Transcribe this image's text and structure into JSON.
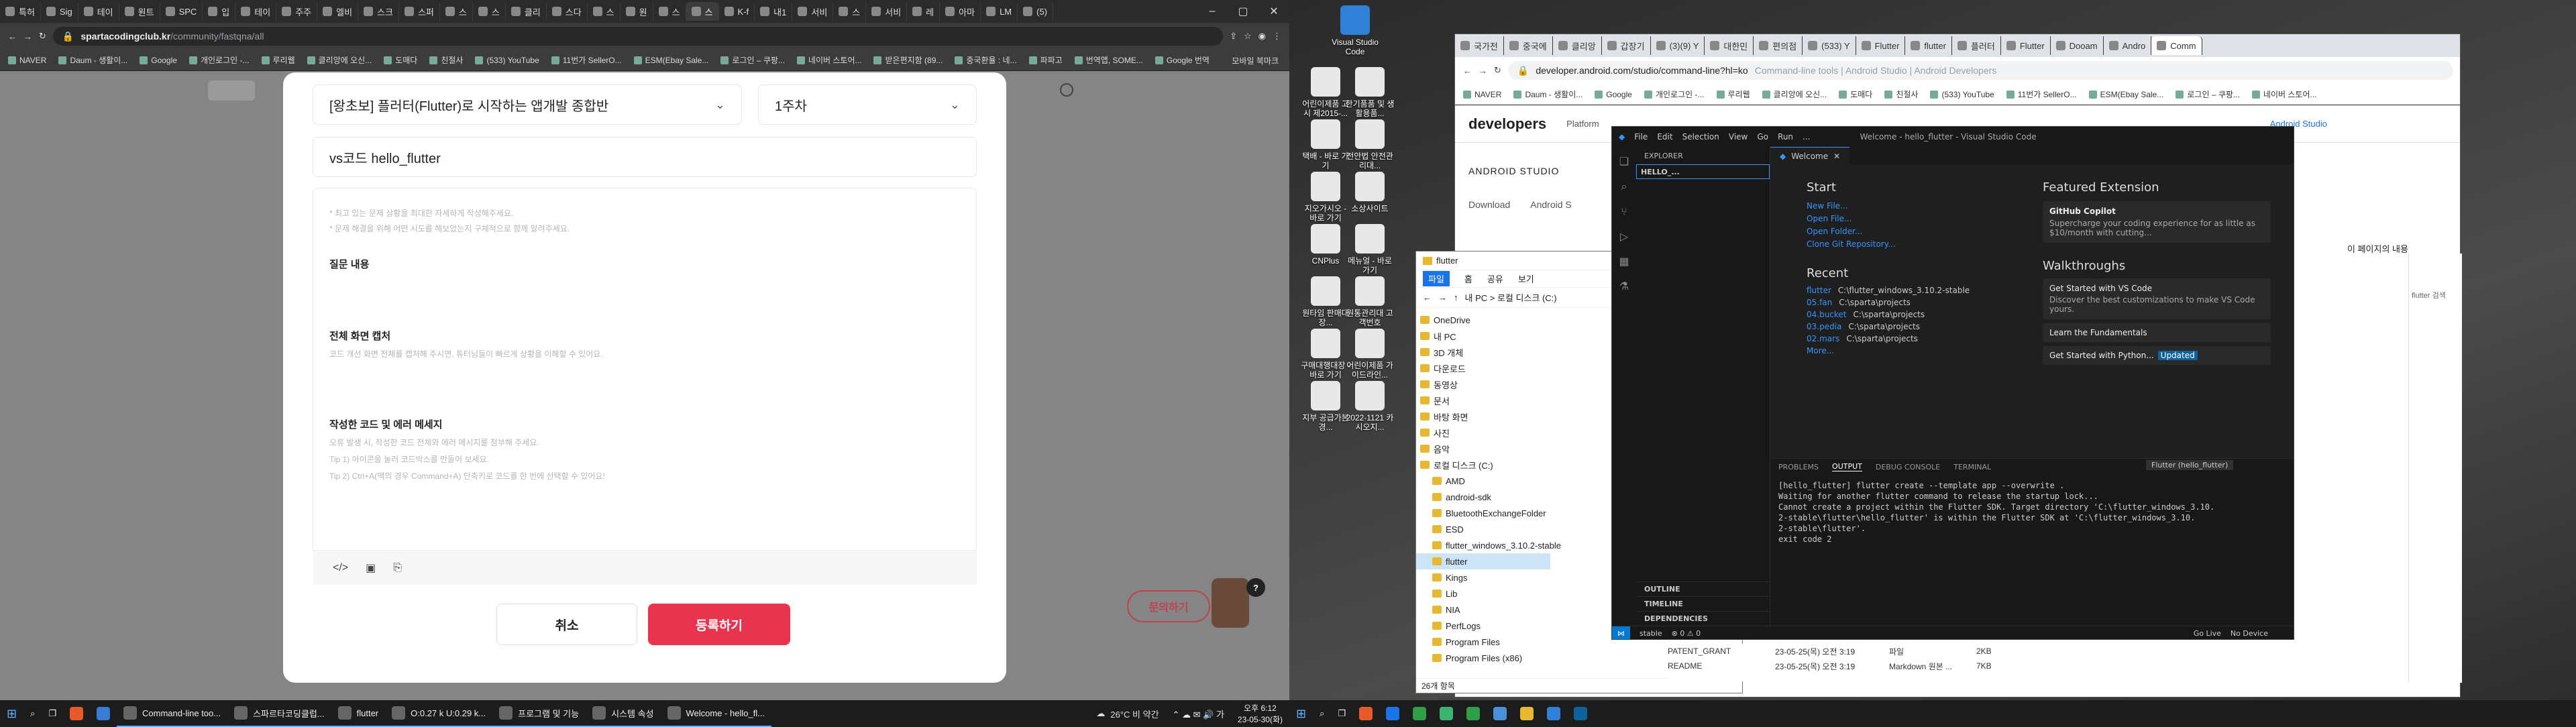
{
  "left_browser": {
    "tabs": [
      "특허",
      "Sig",
      "테이",
      "원트",
      "SPC",
      "입",
      "테이",
      "주주",
      "엘비",
      "스크",
      "스퍼",
      "스",
      "스",
      "클리",
      "스다",
      "스",
      "원",
      "스",
      "스",
      "K-f",
      "내1",
      "서비",
      "스",
      "서비",
      "레",
      "아마",
      "LM",
      "(5)"
    ],
    "active_tab_label": "스",
    "url_domain": "spartacodingclub.kr",
    "url_path": "/community/fastqna/all",
    "bookmarks": [
      "NAVER",
      "Daum - 생활이...",
      "Google",
      "개인로그인 -...",
      "루리웹",
      "클리앙에 오신...",
      "도매다",
      "친절사",
      "(533) YouTube",
      "11번가 SellerO...",
      "ESM(Ebay Sale...",
      "로그인 – 쿠팡...",
      "네이버 스토어...",
      "받은편지함 (89...",
      "중국환율 : 네...",
      "파파고",
      "번역앱, SOME...",
      "Google 번역"
    ],
    "bookmarks_all": "모바일 북마크"
  },
  "modal": {
    "course_select": "[왕초보] 플러터(Flutter)로 시작하는 앱개발 종합반",
    "week_select": "1주차",
    "title_value": "vs코드 hello_flutter",
    "hint1": "* 최고 있는 문제 상황을 최대한 자세하게 작성해주세요.",
    "hint2": "* 문제 해결을 위해 어떤 시도를 해보았는지 구체적으로 함께 알려주세요.",
    "q_header": "질문 내용",
    "screen_header": "전체 화면 캡처",
    "screen_hint": "코드 개선 화면 전체를 캡처해 주시면, 튜터님들이 빠르게 상황을 이해할 수 있어요.",
    "code_header": "작성한 코드 및 에러 메세지",
    "code_hint1": "오류 발생 시, 작성한 코드 전체와 에러 메시지를 첨부해 주세요.",
    "code_hint2": "Tip 1) 아이콘을 눌러 코드박스를 만들어 보세요.",
    "code_hint3": "Tip 2) Ctrl+A(맥의 경우 Command+A) 단축키로 코드를 한 번에 선택할 수 있어요!",
    "cancel_label": "취소",
    "submit_label": "등록하기",
    "help_label": "문의하기",
    "help_badge": "?"
  },
  "left_taskbar": {
    "items": [
      "Command-line too...",
      "스파르타코딩클럽...",
      "flutter",
      "O:0.27 k U:0.29 k...",
      "프로그램 및 기능",
      "시스템 속성",
      "Welcome - hello_fl..."
    ],
    "weather": "26°C 비 약간",
    "time": "오후 6:12",
    "date": "23-05-30(화)"
  },
  "desktop_icons": [
    "Visual Studio Code",
    "어린이제품 고시 제2015-...",
    "한기품품 및 생활용품...",
    "택배 - 바로 가기",
    "전안법 안전관리대...",
    "지오가시오 - 바로 가기",
    "소상사이트",
    "CNPlus",
    "메뉴얼 - 바로 가기",
    "원타임 판매대장...",
    "원통관리대 고객번호",
    "구매대행대장 - 바로 가기",
    "어린이제품 가이드라인...",
    "지부 공급가본경...",
    "2022-1121 카시오지..."
  ],
  "chrome2": {
    "tabs": [
      "국가전",
      "중국에",
      "클리앙",
      "갑장기",
      "(3)(9) Y",
      "대한민",
      "편의점",
      "(533) Y",
      "Flutter",
      "flutter",
      "플러터",
      "Flutter",
      "Dooam",
      "Andro",
      "Comm"
    ],
    "url": "developer.android.com/studio/command-line?hl=ko",
    "url_crumb": "Command-line tools | Android Studio | Android Developers",
    "bookmarks": [
      "NAVER",
      "Daum - 생활이...",
      "Google",
      "개인로그인 -...",
      "루리웹",
      "클리앙에 오신...",
      "도매다",
      "친절사",
      "(533) YouTube",
      "11번가 SellerO...",
      "ESM(Ebay Sale...",
      "로그인 – 쿠팡...",
      "네이버 스토어..."
    ],
    "brand": "developers",
    "nav1": "Platform",
    "nav2": "Android Studio",
    "section": "ANDROID STUDIO",
    "sub1": "Download",
    "sub2": "Android S",
    "page_note": "이 페이지의 내용",
    "search_ph": "flutter 검색"
  },
  "explorer": {
    "title": "flutter",
    "ribbon": [
      "파일",
      "홈",
      "공유",
      "보기"
    ],
    "path": "내 PC > 로컬 디스크 (C:)",
    "tree": [
      "OneDrive",
      "내 PC",
      "3D 개체",
      "다운로드",
      "동영상",
      "문서",
      "바탕 화면",
      "사진",
      "음악",
      "로컬 디스크 (C:)",
      "AMD",
      "android-sdk",
      "BluetoothExchangeFolder",
      "ESD",
      "flutter_windows_3.10.2-stable",
      "flutter",
      "Kings",
      "Lib",
      "NIA",
      "PerfLogs",
      "Program Files",
      "Program Files (x86)"
    ],
    "files": [
      {
        "name": "PATENT_GRANT",
        "date": "23-05-25(목) 오전 3:19",
        "type": "파일",
        "size": "2KB"
      },
      {
        "name": "README",
        "date": "23-05-25(목) 오전 3:19",
        "type": "Markdown 원본 ...",
        "size": "7KB"
      }
    ],
    "status": "26개 항목",
    "status_partial": "파일"
  },
  "vscode": {
    "title": "Welcome - hello_flutter - Visual Studio Code",
    "menu": [
      "File",
      "Edit",
      "Selection",
      "View",
      "Go",
      "Run",
      "..."
    ],
    "explorer_label": "EXPLORER",
    "folder": "HELLO_...",
    "tab": "Welcome",
    "start_header": "Start",
    "start_links": [
      "New File...",
      "Open File...",
      "Open Folder...",
      "Clone Git Repository..."
    ],
    "recent_header": "Recent",
    "recent": [
      {
        "name": "flutter",
        "path": "C:\\flutter_windows_3.10.2-stable"
      },
      {
        "name": "05.fan",
        "path": "C:\\sparta\\projects"
      },
      {
        "name": "04.bucket",
        "path": "C:\\sparta\\projects"
      },
      {
        "name": "03.pedia",
        "path": "C:\\sparta\\projects"
      },
      {
        "name": "02.mars",
        "path": "C:\\sparta\\projects"
      }
    ],
    "more": "More...",
    "featured_header": "Featured Extension",
    "copilot_name": "GitHub Copilot",
    "copilot_desc": "Supercharge your coding experience for as little as $10/month with cutting...",
    "walk_header": "Walkthroughs",
    "walk1_title": "Get Started with VS Code",
    "walk1_desc": "Discover the best customizations to make VS Code yours.",
    "walk2": "Learn the Fundamentals",
    "walk3": "Get Started with Python...",
    "walk3_badge": "Updated",
    "panel_tabs": [
      "PROBLEMS",
      "OUTPUT",
      "DEBUG CONSOLE",
      "TERMINAL"
    ],
    "panel_select": "Flutter (hello_flutter)",
    "output": [
      "[hello_flutter] flutter create --template app --overwrite .",
      "Waiting for another flutter command to release the startup lock...",
      "Cannot create a project within the Flutter SDK. Target directory 'C:\\flutter_windows_3.10.",
      "2-stable\\flutter\\hello_flutter' is within the Flutter SDK at 'C:\\flutter_windows_3.10.",
      "2-stable\\flutter'.",
      "exit code 2"
    ],
    "outline": [
      "OUTLINE",
      "TIMELINE",
      "DEPENDENCIES"
    ],
    "status_branch": "stable",
    "status_problems": "⊗ 0 ⚠ 0",
    "status_live": "Go Live",
    "status_device": "No Device"
  },
  "right_taskbar": {
    "items": [
      "",
      "",
      "",
      "",
      "",
      "",
      "",
      "",
      ""
    ]
  }
}
